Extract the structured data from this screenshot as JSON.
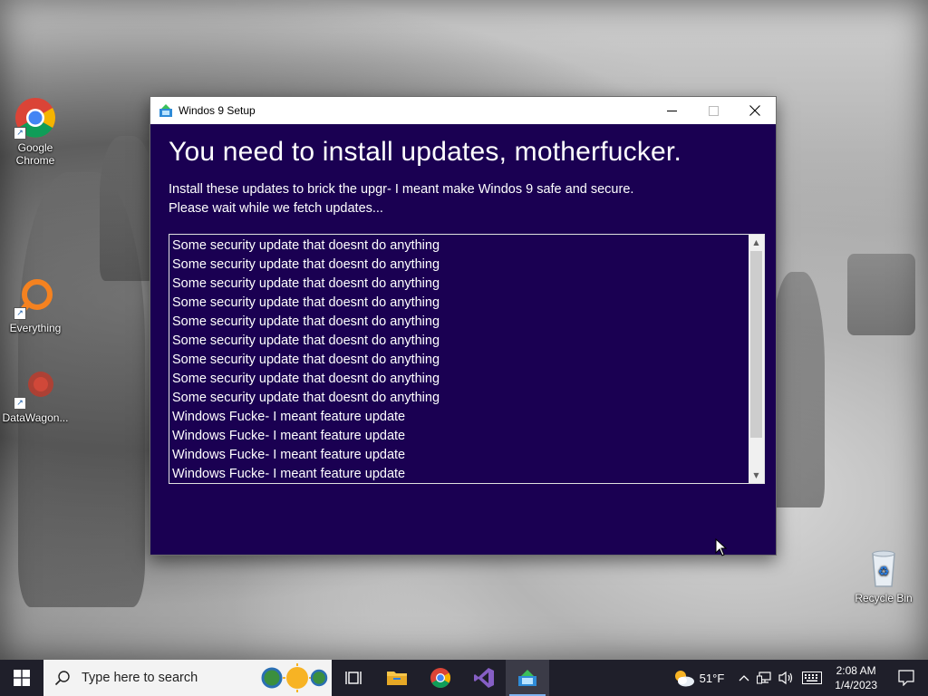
{
  "desktop": {
    "icons": [
      {
        "label": "Google Chrome"
      },
      {
        "label": "Everything"
      },
      {
        "label": "DataWagon..."
      },
      {
        "label": "Recycle Bin"
      }
    ]
  },
  "window": {
    "title": "Windos 9 Setup",
    "headline": "You need to install updates, motherfucker.",
    "subtext_line1": "Install these updates to brick the upgr- I meant make Windos 9 safe and secure.",
    "subtext_line2": "Please wait while we fetch updates...",
    "updates": [
      "Some security update that doesnt do anything",
      "Some security update that doesnt do anything",
      "Some security update that doesnt do anything",
      "Some security update that doesnt do anything",
      "Some security update that doesnt do anything",
      "Some security update that doesnt do anything",
      "Some security update that doesnt do anything",
      "Some security update that doesnt do anything",
      "Some security update that doesnt do anything",
      "Windows Fucke- I meant feature update",
      "Windows Fucke- I meant feature update",
      "Windows Fucke- I meant feature update",
      "Windows Fucke- I meant feature update"
    ],
    "background_color": "#1a0052"
  },
  "taskbar": {
    "search_placeholder": "Type here to search",
    "apps": [
      "file-explorer",
      "chrome",
      "visual-studio",
      "windos-setup"
    ],
    "weather_temp": "51°F",
    "clock_time": "2:08 AM",
    "clock_date": "1/4/2023"
  },
  "colors": {
    "window_bg": "#1a0052",
    "taskbar_bg": "#1f1f2a",
    "accent": "#7fb2f0"
  }
}
